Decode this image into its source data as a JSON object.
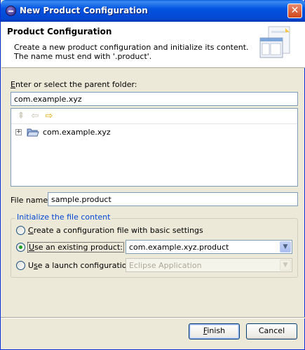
{
  "window": {
    "title": "New Product Configuration",
    "close_glyph": "✕"
  },
  "header": {
    "title": "Product Configuration",
    "description_line1": "Create a new product configuration and initialize its content.",
    "description_line2": "The name must end with '.product'."
  },
  "parent_folder": {
    "label": "Enter or select the parent folder:",
    "value": "com.example.xyz"
  },
  "tree": {
    "toolbar": {
      "home_icon": "home-icon",
      "back_icon": "back-arrow-icon",
      "forward_icon": "forward-arrow-icon"
    },
    "items": [
      {
        "label": "com.example.xyz",
        "expander": "+"
      }
    ]
  },
  "file_name": {
    "label": "File name:",
    "value": "sample.product"
  },
  "init_group": {
    "title": "Initialize the file content",
    "options": [
      {
        "mnemonic": "C",
        "rest": "reate a configuration file with basic settings",
        "checked": false
      },
      {
        "mnemonic": "U",
        "rest": "se an existing product:",
        "checked": true,
        "combo_value": "com.example.xyz.product"
      },
      {
        "prefix": "U",
        "mnemonic": "s",
        "rest": "e a launch configuration:",
        "checked": false,
        "combo_value": "Eclipse Application",
        "disabled": true
      }
    ]
  },
  "buttons": {
    "finish_mnemonic": "F",
    "finish_rest": "inish",
    "cancel_label": "Cancel"
  },
  "colors": {
    "title_blue": "#0454e0",
    "group_title": "#0046d5",
    "face": "#ece9d8"
  }
}
